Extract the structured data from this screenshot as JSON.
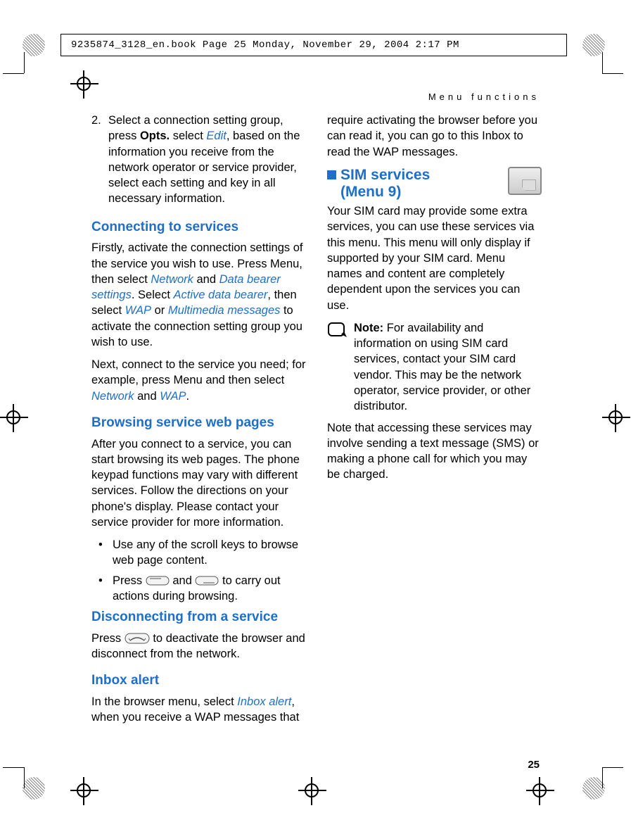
{
  "header_band": "9235874_3128_en.book  Page 25  Monday, November 29, 2004  2:17 PM",
  "running_head": "Menu functions",
  "page_number": "25",
  "col1": {
    "step2_num": "2.",
    "step2_a": "Select a connection setting group, press ",
    "step2_opts": "Opts.",
    "step2_b": " select ",
    "step2_edit": "Edit",
    "step2_c": ", based on the information you receive from the network operator or service provider, select each setting and key in all necessary information.",
    "h_connect": "Connecting to services",
    "p_connect_a": "Firstly, activate the connection settings of the service you wish to use. Press Menu, then select ",
    "network1": "Network",
    "p_connect_b": " and ",
    "dbs": "Data bearer settings",
    "p_connect_c": ". Select ",
    "adb": "Active data bearer",
    "p_connect_d": ", then select ",
    "wap1": "WAP",
    "p_connect_e": " or ",
    "mms": "Multimedia messages",
    "p_connect_f": " to activate the connection setting group you wish to use.",
    "p_next_a": "Next, connect to the service you need; for example, press Menu and then select ",
    "network2": "Network",
    "p_next_b": " and ",
    "wap2": "WAP",
    "p_next_c": ".",
    "h_browsing": "Browsing service web pages",
    "p_brow": "After you connect to a service, you can start browsing its web pages. The phone keypad functions may vary with different services. Follow the directions on your phone's display. Please contact your service provider for more information.",
    "bullet1": "Use any of the scroll keys to browse web page content.",
    "bullet2_a": "Press ",
    "bullet2_b": " and ",
    "bullet2_c": " to carry out actions during browsing."
  },
  "col2": {
    "h_disc": "Disconnecting from a service",
    "p_disc_a": "Press ",
    "p_disc_b": " to deactivate the browser and disconnect from the network.",
    "h_inbox": "Inbox alert",
    "p_inbox_a": "In the browser menu, select ",
    "inbox_alert": "Inbox alert",
    "p_inbox_b": ", when you receive a WAP messages that require activating the browser before you can read it, you can go to this Inbox to read the WAP messages.",
    "sect_line1": "SIM services",
    "sect_line2": "(Menu 9)",
    "p_sim": "Your SIM card may provide some extra services, you can use these services via this menu. This menu will only display if supported by your SIM card. Menu names and content are completely dependent upon the services you can use.",
    "note_label": "Note:",
    "note_body": " For availability and information on using SIM card services, contact your SIM card vendor. This may be the network operator, service provider, or other distributor.",
    "p_charge": "Note that accessing these services may involve sending a text message (SMS) or making a phone call for which you may be charged."
  }
}
